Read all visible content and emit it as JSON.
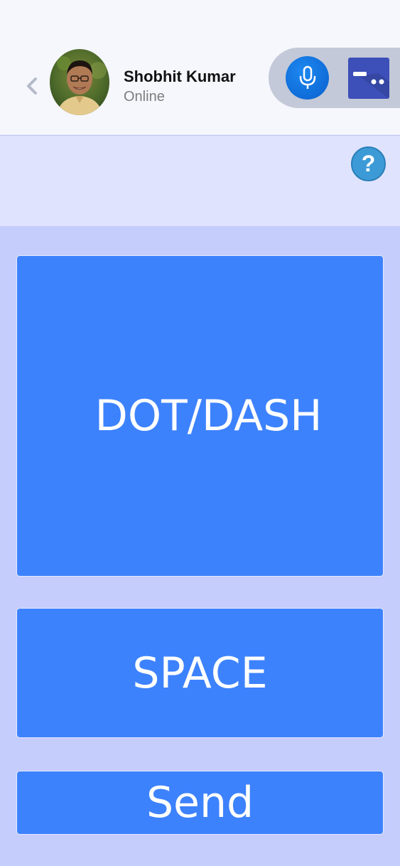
{
  "header": {
    "contact_name": "Shobhit Kumar",
    "contact_status": "Online",
    "back_icon": "chevron-left-icon",
    "mic_icon": "microphone-icon",
    "morse_icon": "morse-code-icon"
  },
  "help": {
    "label": "?"
  },
  "controls": {
    "dotdash_label": "DOT/DASH",
    "space_label": "SPACE",
    "send_label": "Send"
  },
  "colors": {
    "accent": "#3d82fd",
    "background": "#c5cdfd",
    "mic": "#1777e3",
    "morse_button": "#3d4fb8"
  }
}
